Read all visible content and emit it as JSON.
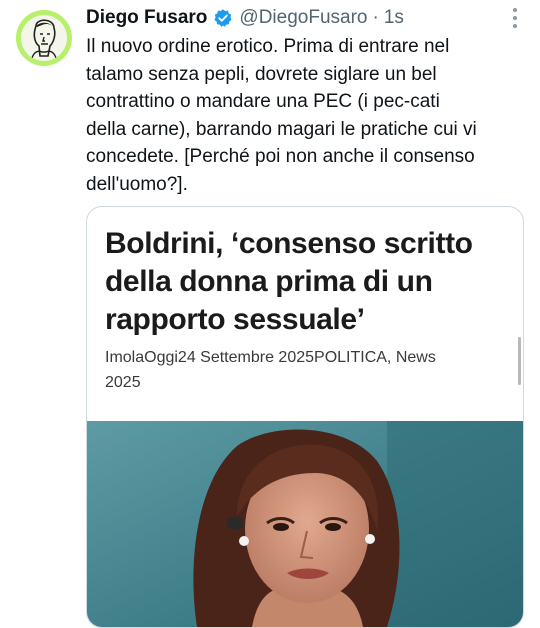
{
  "tweet": {
    "author_name": "Diego Fusaro",
    "handle": "@DiegoFusaro",
    "separator": "·",
    "time": "1s",
    "text_lines": [
      "Il nuovo ordine erotico. Prima di entrare nel",
      "talamo senza pepli, dovrete siglare un bel",
      "contrattino o mandare una PEC (i pec-cati",
      "della carne), barrando magari le pratiche cui vi",
      "concedete. [Perché poi non anche il consenso",
      "dell'uomo?]."
    ]
  },
  "card": {
    "title_lines": [
      "Boldrini, ‘consenso scritto",
      "della donna prima di un",
      "rapporto sessuale’"
    ],
    "meta_lines": [
      "ImolaOggi24 Settembre 2025POLITICA, News",
      "2025"
    ]
  },
  "icons": {
    "verified": "verified-badge-icon",
    "more": "more-options-icon"
  },
  "colors": {
    "avatar_ring": "#b7f06a",
    "verified": "#1d9bf0",
    "secondary_text": "#536471",
    "card_border": "#cfd9de",
    "image_background": "#3f7f8a"
  }
}
